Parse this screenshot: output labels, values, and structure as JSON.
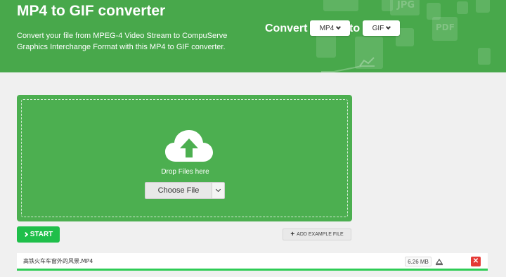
{
  "header": {
    "title": "MP4 to GIF converter",
    "subtitle": "Convert your file from MPEG-4 Video Stream to CompuServe Graphics Interchange Format with this MP4 to GIF converter.",
    "convert_word": "Convert",
    "to_word": "to",
    "from_format": "MP4",
    "to_format": "GIF",
    "bg_jpg": "JPG",
    "bg_pdf": "PDF",
    "accent": "#48a84b"
  },
  "dropzone": {
    "drop_text": "Drop Files here",
    "choose_label": "Choose File",
    "color": "#4caf50"
  },
  "actions": {
    "start_label": "START",
    "example_label": "ADD EXAMPLE FILE"
  },
  "files": [
    {
      "name": "高铁火车车窗外的风景.MP4",
      "size": "6.26 MB"
    }
  ],
  "icons": {
    "upload": "cloud-upload-icon",
    "start": "chevron-right-icon",
    "example": "plus-icon",
    "settings": "settings-icon",
    "delete": "close-icon"
  }
}
